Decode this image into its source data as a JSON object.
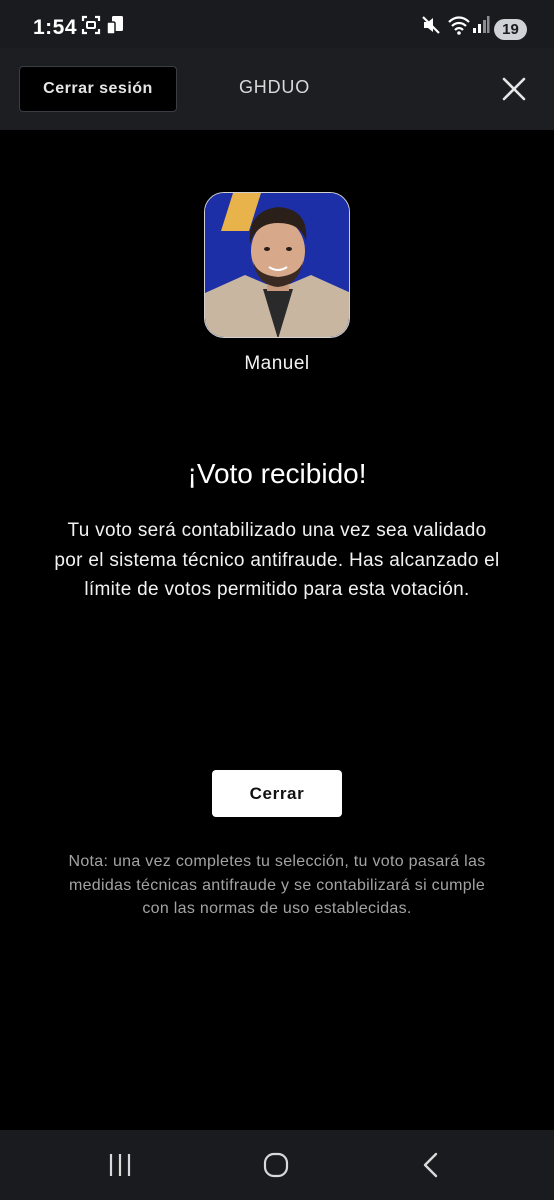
{
  "status_bar": {
    "time": "1:54",
    "battery_level": "19",
    "icons": [
      "screenshot-icon",
      "cast-icon",
      "mute-icon",
      "wifi-icon",
      "signal-icon",
      "battery-icon"
    ]
  },
  "header": {
    "logout_label": "Cerrar sesión",
    "title": "GHDUO",
    "close_icon": "close-icon"
  },
  "contestant": {
    "name": "Manuel"
  },
  "confirmation": {
    "title": "¡Voto recibido!",
    "message": "Tu voto será contabilizado una vez sea validado por el sistema técnico antifraude. Has alcanzado el límite de votos permitido para esta votación.",
    "close_label": "Cerrar"
  },
  "footnote": "Nota: una vez completes tu selección, tu voto pasará las medidas técnicas antifraude y se contabilizará si cumple con las normas de uso establecidas.",
  "nav_bar": {
    "icons": [
      "recent-apps-icon",
      "home-icon",
      "back-icon"
    ]
  },
  "colors": {
    "background": "#000000",
    "header_bg": "#1c1e21",
    "avatar_bg": "#1d2fa6",
    "footnote_text": "#a3a3a3"
  }
}
